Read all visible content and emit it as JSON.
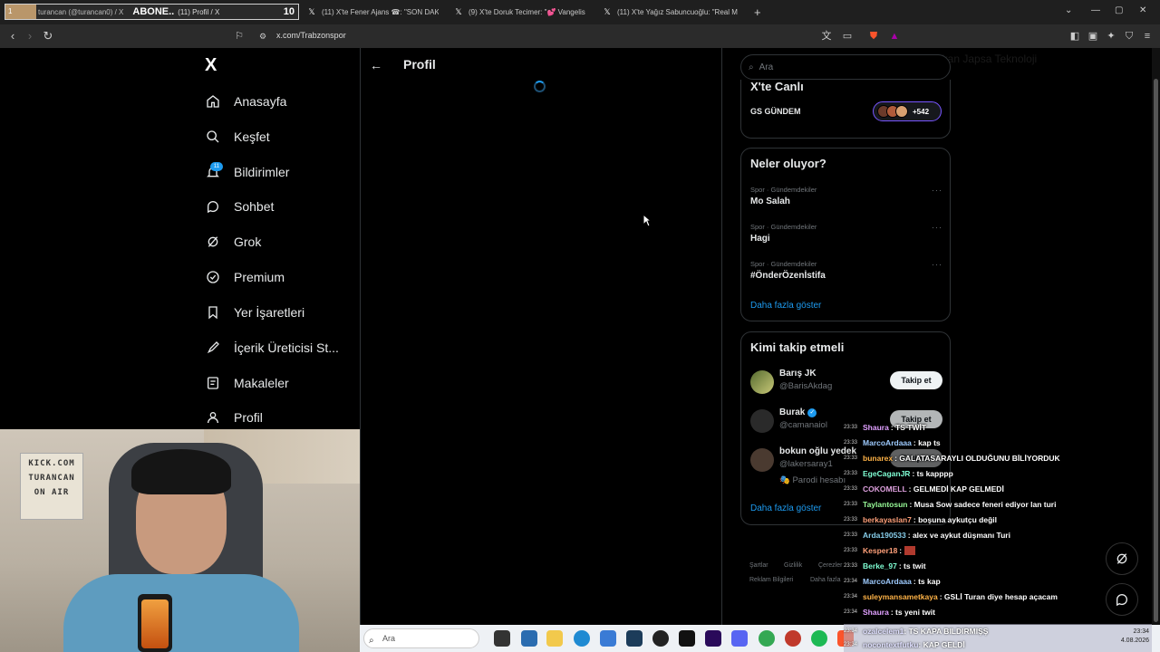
{
  "browser": {
    "tabs": [
      {
        "label": "(11) X'te Fener Ajans ☎: \"SON DAKİK",
        "active": false
      },
      {
        "label": "(9) X'te Doruk Tecimer: \"💕 Vangelis",
        "active": false
      },
      {
        "label": "(11) X'te Yağız Sabuncuoğlu: \"Real M",
        "active": false
      }
    ],
    "overlay_tab": {
      "num": "1",
      "left_text": "turancan (@turancan0) / X",
      "abone": "ABONE..",
      "title": "(11) Profil / X",
      "ten": "10"
    },
    "new_tab": "+",
    "url": "x.com/Trabzonspor"
  },
  "nav": {
    "logo": "X",
    "items": [
      {
        "label": "Anasayfa",
        "icon": "home-icon"
      },
      {
        "label": "Keşfet",
        "icon": "search-icon"
      },
      {
        "label": "Bildirimler",
        "icon": "bell-icon"
      },
      {
        "label": "Sohbet",
        "icon": "chat-icon"
      },
      {
        "label": "Grok",
        "icon": "grok-icon"
      },
      {
        "label": "Premium",
        "icon": "premium-icon"
      },
      {
        "label": "Yer İşaretleri",
        "icon": "bookmark-icon"
      },
      {
        "label": "İçerik Üreticisi St...",
        "icon": "rocket-icon"
      },
      {
        "label": "Makaleler",
        "icon": "article-icon"
      },
      {
        "label": "Profil",
        "icon": "profile-icon"
      }
    ],
    "notif_badge": "11"
  },
  "main": {
    "title": "Profil"
  },
  "search": {
    "placeholder": "Ara"
  },
  "live": {
    "title": "X'te Canlı",
    "label": "GS GÜNDEM",
    "count": "+542"
  },
  "trends": {
    "title": "Neler oluyor?",
    "items": [
      {
        "category": "Spor · Gündemdekiler",
        "name": "Mo Salah"
      },
      {
        "category": "Spor · Gündemdekiler",
        "name": "Hagi"
      },
      {
        "category": "Spor · Gündemdekiler",
        "name": "#ÖnderÖzenİstifa"
      }
    ],
    "more_icon": "···",
    "show_more": "Daha fazla göster"
  },
  "who_to_follow": {
    "title": "Kimi takip etmeli",
    "items": [
      {
        "name": "Barış JK",
        "handle": "@BarisAkdag",
        "button": "Takip et"
      },
      {
        "name": "Burak",
        "handle": "@camanaiol",
        "button": "Takip et",
        "verified": "✓"
      },
      {
        "name": "bokun oğlu yedek",
        "handle": "@lakersaray1",
        "button": "Takip et"
      }
    ],
    "parody": "Parodi hesabı",
    "show_more": "Daha fazla göster"
  },
  "footer": {
    "terms": "Şartlar",
    "privacy": "Gizlilik",
    "cookies": "Çerezler",
    "ads": "Reklam Bilgileri",
    "more": "Daha fazla"
  },
  "watermark": "Bakan Japsa Teknoloji",
  "webcam": {
    "sign_lines": [
      "KICK.COM",
      "TURANCAN",
      "ON AIR"
    ]
  },
  "chat": {
    "lines": [
      {
        "time": "23:33",
        "user": "Shaura",
        "color": "#e0a0ff",
        "msg": ": TS TWİT"
      },
      {
        "time": "23:33",
        "user": "MarcoArdaaa",
        "color": "#9ecbff",
        "msg": ": kap ts"
      },
      {
        "time": "23:33",
        "user": "bunarex",
        "color": "#ffb347",
        "msg": ": GALATASARAYLI OLDUĞUNU BİLİYORDUK"
      },
      {
        "time": "23:33",
        "user": "EgeCaganJR",
        "color": "#7fffd4",
        "msg": ": ts kapppp"
      },
      {
        "time": "23:33",
        "user": "COKOMELL",
        "color": "#dda0dd",
        "msg": ": GELMEDİ KAP GELMEDİ"
      },
      {
        "time": "23:33",
        "user": "Taylantosun",
        "color": "#98fb98",
        "msg": ": Musa Sow sadece feneri ediyor lan turi"
      },
      {
        "time": "23:33",
        "user": "berkayaslan7",
        "color": "#ffa07a",
        "msg": ": boşuna aykutçu değil"
      },
      {
        "time": "23:33",
        "user": "Arda190533",
        "color": "#87ceeb",
        "msg": ": alex ve aykut düşmanı Turi"
      },
      {
        "time": "23:33",
        "user": "Kesper18",
        "color": "#ffa07a",
        "msg": ":"
      },
      {
        "time": "23:33",
        "user": "Berke_97",
        "color": "#7fffd4",
        "msg": ": ts twit"
      },
      {
        "time": "23:34",
        "user": "MarcoArdaaa",
        "color": "#9ecbff",
        "msg": ": ts kap"
      },
      {
        "time": "23:34",
        "user": "suleymansametkaya",
        "color": "#ffb347",
        "msg": ": GSLİ Turan diye hesap açacam"
      },
      {
        "time": "23:34",
        "user": "Shaura",
        "color": "#e0a0ff",
        "msg": ": ts yeni twit"
      }
    ],
    "bottom_lines": [
      {
        "time": "23:34",
        "user": "ozalcelem1",
        "msg": ": TS KAPA BILDIRMIŞŞ"
      },
      {
        "time": "23:34",
        "user": "nocontextfutku",
        "msg": ": KAP GELDİ"
      }
    ]
  },
  "taskbar": {
    "search_placeholder": "Ara",
    "time": "23:34",
    "date": "4.08.2026"
  }
}
